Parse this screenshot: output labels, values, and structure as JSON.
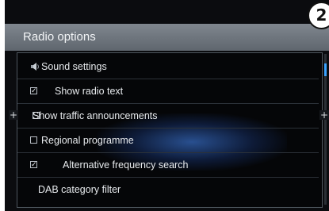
{
  "window": {
    "title": "Radio options"
  },
  "callout_number": "2",
  "menu": {
    "items": [
      {
        "label": "Sound settings",
        "icon": "speaker-icon"
      },
      {
        "label": "Show radio text",
        "checked": true
      },
      {
        "label": "Show traffic announcements",
        "checked": false
      },
      {
        "label": "Regional programme",
        "checked": false
      },
      {
        "label": "Alternative frequency search",
        "checked": true
      },
      {
        "label": "DAB category filter"
      }
    ]
  },
  "controls": {
    "plus_left": "+",
    "plus_right": "+"
  },
  "colors": {
    "accent": "#3aa3ff",
    "title_bar": "#6f767e",
    "background": "#0b0c0f"
  }
}
